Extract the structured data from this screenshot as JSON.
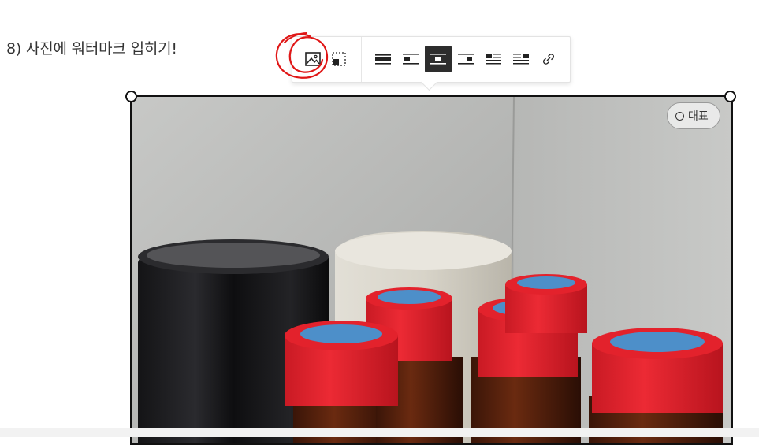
{
  "step": {
    "text": "8) 사진에 워터마크 입히기!"
  },
  "toolbar": {
    "buttons": [
      {
        "name": "image-edit-icon"
      },
      {
        "name": "crop-icon"
      },
      {
        "name": "align-full-icon"
      },
      {
        "name": "align-left-icon"
      },
      {
        "name": "align-center-icon",
        "active": true
      },
      {
        "name": "align-right-icon"
      },
      {
        "name": "wrap-left-icon"
      },
      {
        "name": "wrap-right-icon"
      },
      {
        "name": "link-icon"
      }
    ]
  },
  "image": {
    "representative_label": "대표"
  },
  "colors": {
    "annotation_red": "#e01616",
    "active_button": "#2d2d2d",
    "cap_red": "#e3222c"
  }
}
